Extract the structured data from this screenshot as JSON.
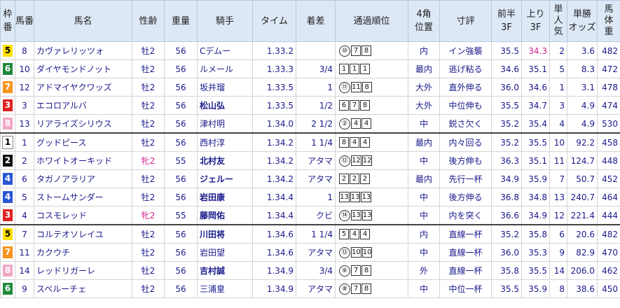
{
  "headers": {
    "waku": "枠番",
    "umaban": "馬番",
    "name": "馬名",
    "sexage": "性齢",
    "weight": "重量",
    "jockey": "騎手",
    "time": "タイム",
    "margin": "着差",
    "passing": "通過順位",
    "corner_line1": "4角",
    "corner_line2": "位置",
    "comment": "寸評",
    "first3f_line1": "前半",
    "first3f_line2": "3F",
    "last3f_line1": "上り",
    "last3f_line2": "3F",
    "pop_line1": "単",
    "pop_line2": "人",
    "pop_line3": "気",
    "odds_line1": "単勝",
    "odds_line2": "オッズ",
    "bw_line1": "馬",
    "bw_line2": "体",
    "bw_line3": "重"
  },
  "rows": [
    {
      "waku": "5",
      "umaban": "8",
      "name": "カヴァレリッツォ",
      "sexage": "牡2",
      "weight": "56",
      "jockey": "Cデムー",
      "time": "1.33.2",
      "margin": "",
      "passing": [
        {
          "n": "⑩",
          "circ": true
        },
        {
          "n": "7",
          "circ": false
        },
        {
          "n": "8",
          "circ": false
        }
      ],
      "corner": "内",
      "comment": "イン強襲",
      "first3f": "35.5",
      "last3f": "34.3",
      "pop": "2",
      "odds": "3.6",
      "bw": "482",
      "female": false,
      "bold_jockey": false,
      "hl_last3f": true,
      "group_start": false
    },
    {
      "waku": "6",
      "umaban": "10",
      "name": "ダイヤモンドノット",
      "sexage": "牡2",
      "weight": "56",
      "jockey": "ルメール",
      "time": "1.33.3",
      "margin": "3/4",
      "passing": [
        {
          "n": "1",
          "circ": false
        },
        {
          "n": "1",
          "circ": false
        },
        {
          "n": "1",
          "circ": false
        }
      ],
      "corner": "最内",
      "comment": "逃げ粘る",
      "first3f": "34.6",
      "last3f": "35.1",
      "pop": "5",
      "odds": "8.3",
      "bw": "472",
      "female": false,
      "bold_jockey": false,
      "hl_last3f": false,
      "group_start": false
    },
    {
      "waku": "7",
      "umaban": "12",
      "name": "アドマイヤクワッズ",
      "sexage": "牡2",
      "weight": "56",
      "jockey": "坂井瑠",
      "time": "1.33.5",
      "margin": "1",
      "passing": [
        {
          "n": "⑪",
          "circ": true
        },
        {
          "n": "11",
          "circ": false
        },
        {
          "n": "8",
          "circ": false
        }
      ],
      "corner": "大外",
      "comment": "直外伸る",
      "first3f": "36.0",
      "last3f": "34.6",
      "pop": "1",
      "odds": "3.1",
      "bw": "478",
      "female": false,
      "bold_jockey": false,
      "hl_last3f": false,
      "group_start": false
    },
    {
      "waku": "3",
      "umaban": "3",
      "name": "エコロアルバ",
      "sexage": "牡2",
      "weight": "56",
      "jockey": "松山弘",
      "time": "1.33.5",
      "margin": "1/2",
      "passing": [
        {
          "n": "6",
          "circ": false
        },
        {
          "n": "7",
          "circ": false
        },
        {
          "n": "8",
          "circ": false
        }
      ],
      "corner": "大外",
      "comment": "中位伸も",
      "first3f": "35.5",
      "last3f": "34.7",
      "pop": "3",
      "odds": "4.9",
      "bw": "474",
      "female": false,
      "bold_jockey": true,
      "hl_last3f": false,
      "group_start": false
    },
    {
      "waku": "8",
      "umaban": "13",
      "name": "リアライズシリウス",
      "sexage": "牡2",
      "weight": "56",
      "jockey": "津村明",
      "time": "1.34.0",
      "margin": "2 1/2",
      "passing": [
        {
          "n": "②",
          "circ": true
        },
        {
          "n": "4",
          "circ": false
        },
        {
          "n": "4",
          "circ": false
        }
      ],
      "corner": "中",
      "comment": "鋭さ欠く",
      "first3f": "35.2",
      "last3f": "35.4",
      "pop": "4",
      "odds": "4.9",
      "bw": "530",
      "female": false,
      "bold_jockey": false,
      "hl_last3f": false,
      "group_start": false
    },
    {
      "waku": "1",
      "umaban": "1",
      "name": "グッドピース",
      "sexage": "牡2",
      "weight": "56",
      "jockey": "西村淳",
      "time": "1.34.2",
      "margin": "1 1/4",
      "passing": [
        {
          "n": "8",
          "circ": false
        },
        {
          "n": "4",
          "circ": false
        },
        {
          "n": "4",
          "circ": false
        }
      ],
      "corner": "最内",
      "comment": "内々回る",
      "first3f": "35.2",
      "last3f": "35.5",
      "pop": "10",
      "odds": "92.2",
      "bw": "458",
      "female": false,
      "bold_jockey": false,
      "hl_last3f": false,
      "group_start": true
    },
    {
      "waku": "2",
      "umaban": "2",
      "name": "ホワイトオーキッド",
      "sexage": "牝2",
      "weight": "55",
      "jockey": "北村友",
      "time": "1.34.2",
      "margin": "アタマ",
      "passing": [
        {
          "n": "⑫",
          "circ": true
        },
        {
          "n": "12",
          "circ": false
        },
        {
          "n": "12",
          "circ": false
        }
      ],
      "corner": "中",
      "comment": "後方伸も",
      "first3f": "36.3",
      "last3f": "35.1",
      "pop": "11",
      "odds": "124.7",
      "bw": "448",
      "female": true,
      "bold_jockey": true,
      "hl_last3f": false,
      "group_start": false
    },
    {
      "waku": "4",
      "umaban": "6",
      "name": "タガノアラリア",
      "sexage": "牡2",
      "weight": "56",
      "jockey": "ジェルー",
      "time": "1.34.2",
      "margin": "アタマ",
      "passing": [
        {
          "n": "2",
          "circ": false
        },
        {
          "n": "2",
          "circ": false
        },
        {
          "n": "2",
          "circ": false
        }
      ],
      "corner": "最内",
      "comment": "先行一杯",
      "first3f": "34.9",
      "last3f": "35.9",
      "pop": "7",
      "odds": "50.7",
      "bw": "452",
      "female": false,
      "bold_jockey": true,
      "hl_last3f": false,
      "group_start": false
    },
    {
      "waku": "4",
      "umaban": "5",
      "name": "ストームサンダー",
      "sexage": "牡2",
      "weight": "56",
      "jockey": "岩田康",
      "time": "1.34.4",
      "margin": "1",
      "passing": [
        {
          "n": "13",
          "circ": false
        },
        {
          "n": "13",
          "circ": false
        },
        {
          "n": "13",
          "circ": false
        }
      ],
      "corner": "中",
      "comment": "後方伸る",
      "first3f": "36.8",
      "last3f": "34.8",
      "pop": "13",
      "odds": "240.7",
      "bw": "464",
      "female": false,
      "bold_jockey": true,
      "hl_last3f": false,
      "group_start": false
    },
    {
      "waku": "3",
      "umaban": "4",
      "name": "コスモレッド",
      "sexage": "牝2",
      "weight": "55",
      "jockey": "藤岡佑",
      "time": "1.34.4",
      "margin": "クビ",
      "passing": [
        {
          "n": "⑭",
          "circ": true
        },
        {
          "n": "13",
          "circ": false
        },
        {
          "n": "13",
          "circ": false
        }
      ],
      "corner": "中",
      "comment": "内を突く",
      "first3f": "36.6",
      "last3f": "34.9",
      "pop": "12",
      "odds": "221.4",
      "bw": "444",
      "female": true,
      "bold_jockey": true,
      "hl_last3f": false,
      "group_start": false
    },
    {
      "waku": "5",
      "umaban": "7",
      "name": "コルテオソレイユ",
      "sexage": "牡2",
      "weight": "56",
      "jockey": "川田将",
      "time": "1.34.6",
      "margin": "1 1/4",
      "passing": [
        {
          "n": "5",
          "circ": false
        },
        {
          "n": "4",
          "circ": false
        },
        {
          "n": "4",
          "circ": false
        }
      ],
      "corner": "内",
      "comment": "直線一杯",
      "first3f": "35.2",
      "last3f": "35.8",
      "pop": "6",
      "odds": "20.6",
      "bw": "482",
      "female": false,
      "bold_jockey": true,
      "hl_last3f": false,
      "group_start": true
    },
    {
      "waku": "7",
      "umaban": "11",
      "name": "カクウチ",
      "sexage": "牡2",
      "weight": "56",
      "jockey": "岩田望",
      "time": "1.34.6",
      "margin": "アタマ",
      "passing": [
        {
          "n": "⑫",
          "circ": true
        },
        {
          "n": "10",
          "circ": false
        },
        {
          "n": "10",
          "circ": false
        }
      ],
      "corner": "中",
      "comment": "直線一杯",
      "first3f": "36.0",
      "last3f": "35.3",
      "pop": "9",
      "odds": "82.9",
      "bw": "470",
      "female": false,
      "bold_jockey": false,
      "hl_last3f": false,
      "group_start": false
    },
    {
      "waku": "8",
      "umaban": "14",
      "name": "レッドリガーレ",
      "sexage": "牡2",
      "weight": "56",
      "jockey": "吉村誠",
      "time": "1.34.9",
      "margin": "3/4",
      "passing": [
        {
          "n": "⑥",
          "circ": true
        },
        {
          "n": "7",
          "circ": false
        },
        {
          "n": "8",
          "circ": false
        }
      ],
      "corner": "外",
      "comment": "直線一杯",
      "first3f": "35.8",
      "last3f": "35.5",
      "pop": "14",
      "odds": "206.0",
      "bw": "462",
      "female": false,
      "bold_jockey": true,
      "hl_last3f": false,
      "group_start": false
    },
    {
      "waku": "6",
      "umaban": "9",
      "name": "スペルーチェ",
      "sexage": "牡2",
      "weight": "56",
      "jockey": "三浦皇",
      "time": "1.34.9",
      "margin": "アタマ",
      "passing": [
        {
          "n": "⑧",
          "circ": true
        },
        {
          "n": "7",
          "circ": false
        },
        {
          "n": "8",
          "circ": false
        }
      ],
      "corner": "中",
      "comment": "中位一杯",
      "first3f": "35.5",
      "last3f": "35.9",
      "pop": "8",
      "odds": "38.6",
      "bw": "450",
      "female": false,
      "bold_jockey": false,
      "hl_last3f": false,
      "group_start": false
    }
  ]
}
